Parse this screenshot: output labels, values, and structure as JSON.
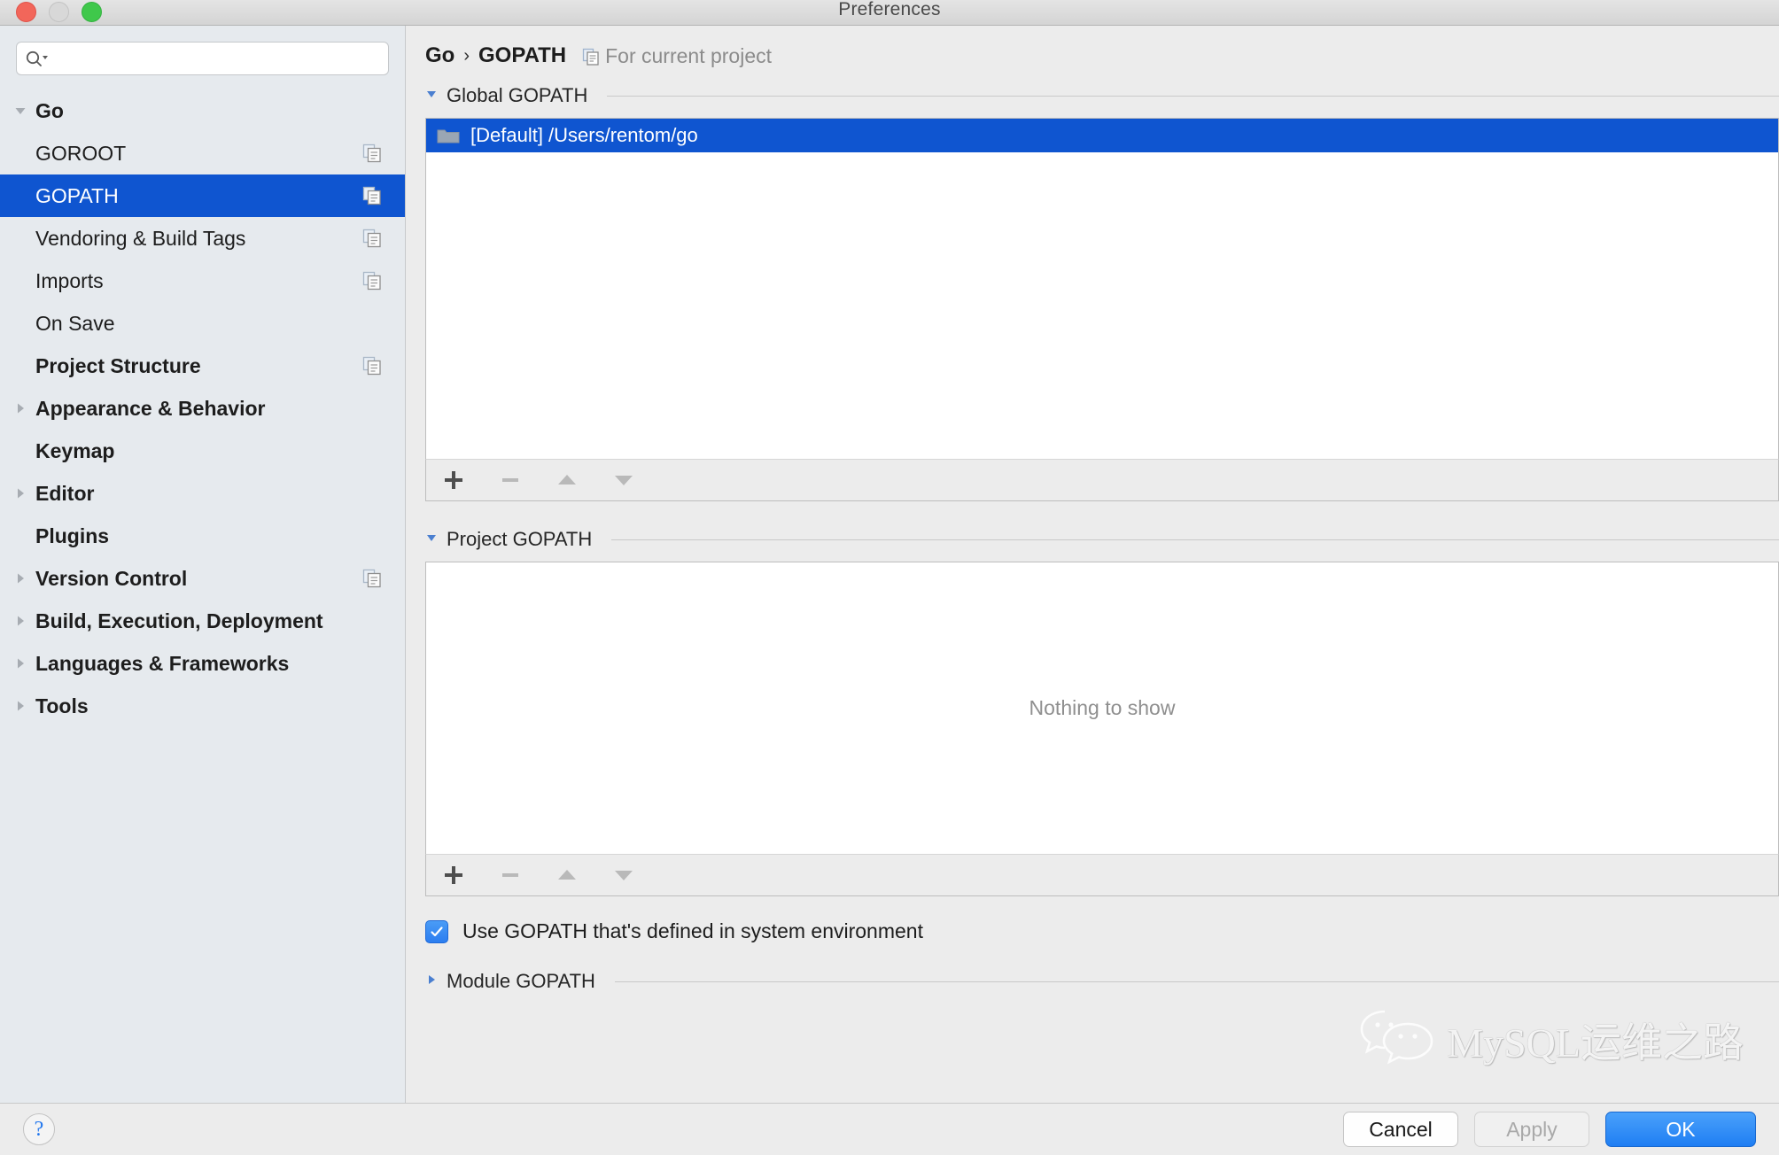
{
  "window": {
    "title": "Preferences",
    "traffic_lights": [
      "close",
      "minimize",
      "maximize"
    ]
  },
  "sidebar": {
    "search": {
      "value": "",
      "placeholder": ""
    },
    "items": [
      {
        "label": "Go",
        "level": 0,
        "expanded": true,
        "bold": true,
        "selected": false,
        "copy": false
      },
      {
        "label": "GOROOT",
        "level": 1,
        "expanded": null,
        "bold": false,
        "selected": false,
        "copy": true
      },
      {
        "label": "GOPATH",
        "level": 1,
        "expanded": null,
        "bold": false,
        "selected": true,
        "copy": true
      },
      {
        "label": "Vendoring & Build Tags",
        "level": 1,
        "expanded": null,
        "bold": false,
        "selected": false,
        "copy": true
      },
      {
        "label": "Imports",
        "level": 1,
        "expanded": null,
        "bold": false,
        "selected": false,
        "copy": true
      },
      {
        "label": "On Save",
        "level": 1,
        "expanded": null,
        "bold": false,
        "selected": false,
        "copy": false
      },
      {
        "label": "Project Structure",
        "level": 0,
        "expanded": null,
        "bold": true,
        "selected": false,
        "copy": true
      },
      {
        "label": "Appearance & Behavior",
        "level": 0,
        "expanded": false,
        "bold": true,
        "selected": false,
        "copy": false
      },
      {
        "label": "Keymap",
        "level": 0,
        "expanded": null,
        "bold": true,
        "selected": false,
        "copy": false
      },
      {
        "label": "Editor",
        "level": 0,
        "expanded": false,
        "bold": true,
        "selected": false,
        "copy": false
      },
      {
        "label": "Plugins",
        "level": 0,
        "expanded": null,
        "bold": true,
        "selected": false,
        "copy": false
      },
      {
        "label": "Version Control",
        "level": 0,
        "expanded": false,
        "bold": true,
        "selected": false,
        "copy": true
      },
      {
        "label": "Build, Execution, Deployment",
        "level": 0,
        "expanded": false,
        "bold": true,
        "selected": false,
        "copy": false
      },
      {
        "label": "Languages & Frameworks",
        "level": 0,
        "expanded": false,
        "bold": true,
        "selected": false,
        "copy": false
      },
      {
        "label": "Tools",
        "level": 0,
        "expanded": false,
        "bold": true,
        "selected": false,
        "copy": false
      }
    ]
  },
  "main": {
    "breadcrumb": {
      "root": "Go",
      "separator": "›",
      "current": "GOPATH",
      "note": "For current project"
    },
    "global_section": {
      "title": "Global GOPATH",
      "expanded": true,
      "rows": [
        {
          "label": "[Default] /Users/rentom/go",
          "selected": true,
          "icon": "folder-icon"
        }
      ],
      "toolbar": [
        {
          "name": "add-button",
          "glyph": "+",
          "enabled": true
        },
        {
          "name": "remove-button",
          "glyph": "−",
          "enabled": false
        },
        {
          "name": "move-up-button",
          "glyph": "▲",
          "enabled": false
        },
        {
          "name": "move-down-button",
          "glyph": "▼",
          "enabled": false
        }
      ]
    },
    "project_section": {
      "title": "Project GOPATH",
      "expanded": true,
      "empty_text": "Nothing to show",
      "toolbar": [
        {
          "name": "add-button",
          "glyph": "+",
          "enabled": true
        },
        {
          "name": "remove-button",
          "glyph": "−",
          "enabled": false
        },
        {
          "name": "move-up-button",
          "glyph": "▲",
          "enabled": false
        },
        {
          "name": "move-down-button",
          "glyph": "▼",
          "enabled": false
        }
      ]
    },
    "system_env_checkbox": {
      "label": "Use GOPATH that's defined in system environment",
      "checked": true
    },
    "module_section": {
      "title": "Module GOPATH",
      "expanded": false
    },
    "watermark": {
      "text": "MySQL运维之路",
      "icon": "wechat-logo-icon"
    }
  },
  "footer": {
    "help_label": "?",
    "cancel_label": "Cancel",
    "apply_label": "Apply",
    "apply_enabled": false,
    "ok_label": "OK"
  },
  "colors": {
    "selection_blue": "#0f55d0",
    "accent_blue": "#2b7df0",
    "sidebar_bg": "#e6eaee",
    "panel_bg": "#ececec",
    "muted_text": "#8b8b8b"
  }
}
